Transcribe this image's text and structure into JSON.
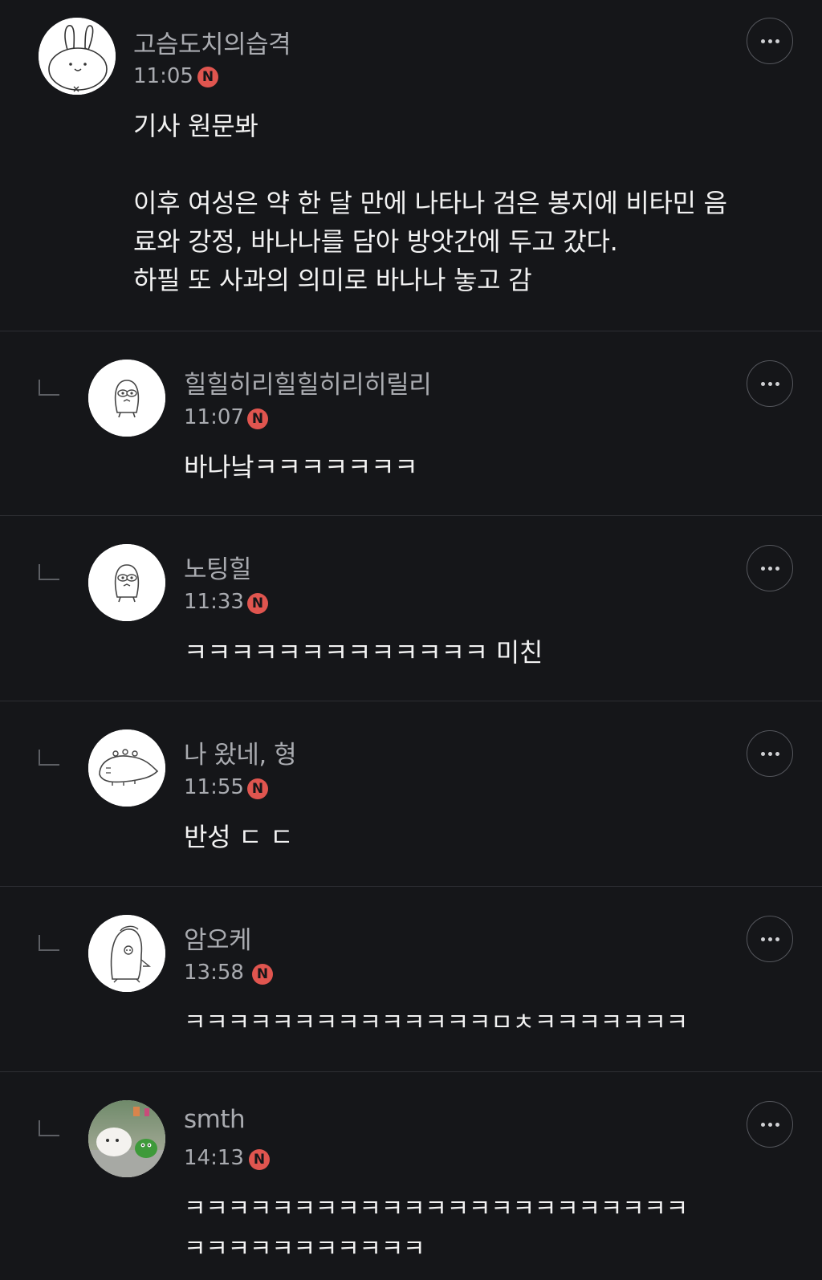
{
  "comments": [
    {
      "author": "고슴도치의습격",
      "time": "11:05",
      "badge": "N",
      "text": "기사 원문봐\n\n이후 여성은 약 한 달 만에 나타나 검은 봉지에 비타민 음\n료와 강정, 바나나를 담아 방앗간에 두고 갔다.\n하필 또 사과의 의미로 바나나 놓고 감",
      "avatar": "rabbit-avatar"
    },
    {
      "author": "힐힐히리힐힐히리히릴리",
      "time": "11:07",
      "badge": "N",
      "text": "바나낰ㅋㅋㅋㅋㅋㅋㅋ",
      "avatar": "creature-avatar"
    },
    {
      "author": "노팅힐",
      "time": "11:33",
      "badge": "N",
      "text": "ㅋㅋㅋㅋㅋㅋㅋㅋㅋㅋㅋㅋㅋ 미친",
      "avatar": "creature-avatar"
    },
    {
      "author": "나 왔네, 형",
      "time": "11:55",
      "badge": "N",
      "text": "반성 ㄷ ㄷ",
      "avatar": "lizard-avatar"
    },
    {
      "author": "암오케",
      "time": "13:58",
      "badge": "N",
      "text": "ㅋㅋㅋㅋㅋㅋㅋㅋㅋㅋㅋㅋㅋㅋㅁㅊㅋㅋㅋㅋㅋㅋㅋ",
      "avatar": "penguin-avatar"
    },
    {
      "author": "smth",
      "time": "14:13",
      "badge": "N",
      "text": "ㅋㅋㅋㅋㅋㅋㅋㅋㅋㅋㅋㅋㅋㅋㅋㅋㅋㅋㅋㅋㅋㅋㅋ\nㅋㅋㅋㅋㅋㅋㅋㅋㅋㅋㅋ",
      "avatar": "photo-avatar"
    }
  ],
  "colors": {
    "background": "#151619",
    "badge": "#e0554f",
    "meta_text": "#a9abb0",
    "body_text": "#f2f2f2",
    "divider": "#2d2e33"
  },
  "icons": {
    "more": "more-options-icon",
    "reply": "reply-indent-icon",
    "new_badge": "new-badge-icon"
  }
}
